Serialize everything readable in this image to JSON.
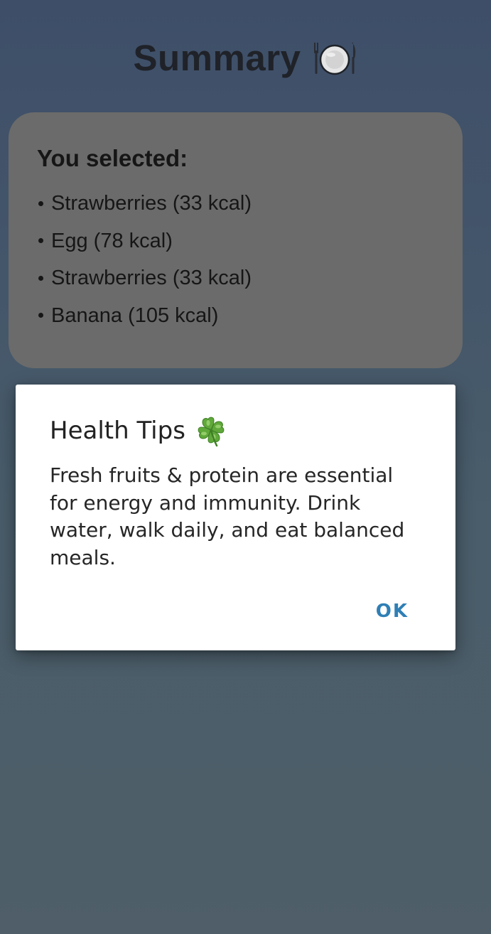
{
  "header": {
    "title": "Summary",
    "title_icon": "plate-cutlery-icon"
  },
  "summary_card": {
    "heading": "You selected:",
    "items": [
      {
        "label": "Strawberries (33 kcal)"
      },
      {
        "label": "Egg (78 kcal)"
      },
      {
        "label": "Strawberries (33 kcal)"
      },
      {
        "label": "Banana (105 kcal)"
      }
    ]
  },
  "dialog": {
    "title": "Health Tips",
    "title_icon": "four-leaf-clover-icon",
    "message": "Fresh fruits & protein are essential for energy and immunity. Drink water, walk daily, and eat balanced meals.",
    "ok_label": "OK"
  },
  "colors": {
    "background_top": "#3e4e69",
    "background_bottom": "#4f5e68",
    "card_background": "#6b6b6b",
    "dialog_background": "#ffffff",
    "accent": "#2f7fb5"
  }
}
